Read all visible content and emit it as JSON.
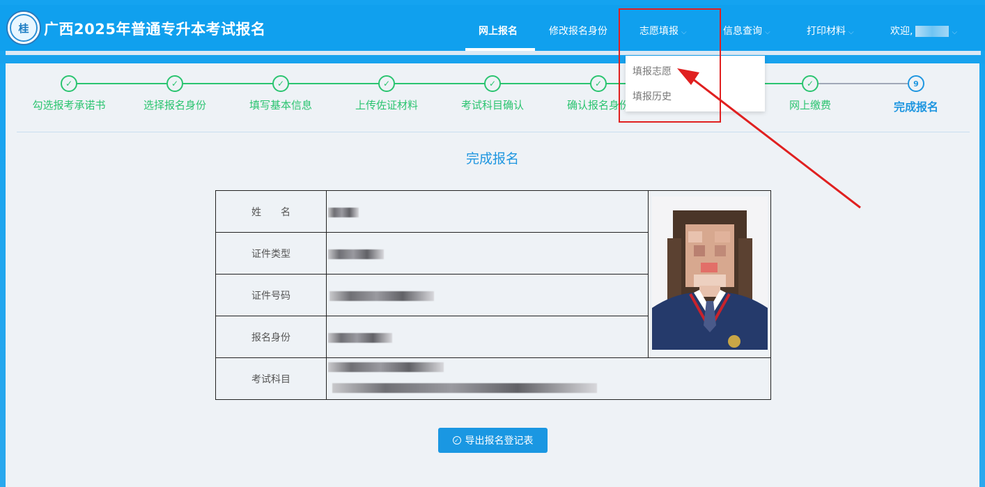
{
  "header": {
    "site_title": "广西2025年普通专升本考试报名",
    "logo_text": "桂",
    "nav": [
      {
        "label": "网上报名"
      },
      {
        "label": "修改报名身份"
      },
      {
        "label": "志愿填报"
      },
      {
        "label": "信息查询"
      },
      {
        "label": "打印材料"
      },
      {
        "label": "欢迎,"
      }
    ]
  },
  "dropdown": {
    "items": [
      {
        "label": "填报志愿"
      },
      {
        "label": "填报历史"
      }
    ]
  },
  "steps": [
    {
      "label": "勾选报考承诺书",
      "mark": "✓"
    },
    {
      "label": "选择报名身份",
      "mark": "✓"
    },
    {
      "label": "填写基本信息",
      "mark": "✓"
    },
    {
      "label": "上传佐证材料",
      "mark": "✓"
    },
    {
      "label": "考试科目确认",
      "mark": "✓"
    },
    {
      "label": "确认报名身份",
      "mark": "✓"
    },
    {
      "label": "网上缴费",
      "mark": "✓"
    },
    {
      "label": "完成报名",
      "mark": "9"
    }
  ],
  "main": {
    "section_title": "完成报名",
    "table": {
      "rows": [
        {
          "label": "姓　　名"
        },
        {
          "label": "证件类型"
        },
        {
          "label": "证件号码"
        },
        {
          "label": "报名身份"
        },
        {
          "label": "考试科目"
        }
      ]
    },
    "export_button": "导出报名登记表",
    "export_icon": "✓"
  },
  "colors": {
    "header_blue": "#10a0ee",
    "step_green": "#2bc470",
    "active_blue": "#1e96e0",
    "annotation_red": "#e02020"
  }
}
